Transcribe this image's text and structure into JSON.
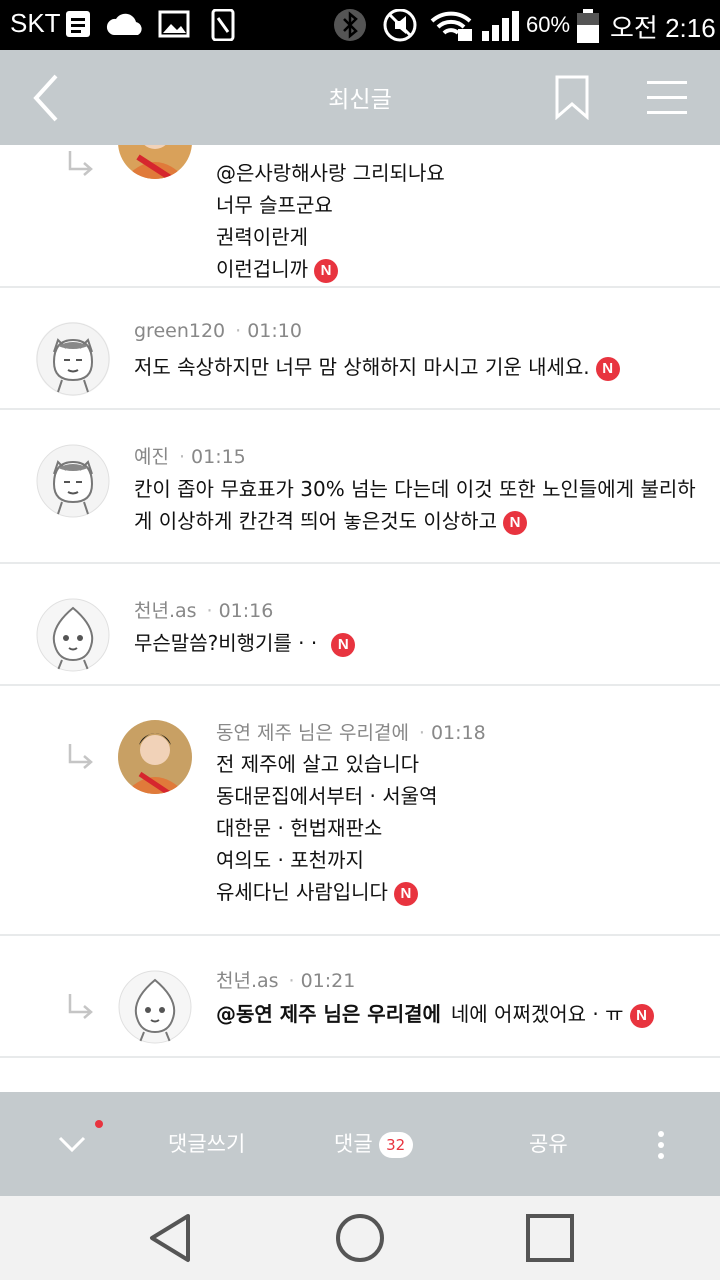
{
  "status": {
    "carrier": "SKT",
    "battery": "60%",
    "time": "오전 2:16"
  },
  "header": {
    "title": "최신글"
  },
  "comments": [
    {
      "author": "",
      "time": "",
      "lines": [
        "@은사랑해사랑 그리되나요",
        "너무 슬프군요",
        "권력이란게",
        "이런겁니까"
      ]
    },
    {
      "author": "green120",
      "time": "01:10",
      "lines": [
        "저도 속상하지만 너무 맘 상해하지 마시고 기운 내세요."
      ]
    },
    {
      "author": "예진",
      "time": "01:15",
      "lines": [
        "칸이 좁아 무효표가 30% 넘는 다는데 이것 또한 노인들에게 불리하",
        "게 이상하게 칸간격 띄어 놓은것도 이상하고"
      ]
    },
    {
      "author": "천년.as",
      "time": "01:16",
      "lines": [
        "무슨말씀?비행기를 · ·"
      ]
    },
    {
      "author": "동연 제주 님은 우리곁에",
      "time": "01:18",
      "lines": [
        "전 제주에 살고 있습니다",
        "동대문집에서부터 · 서울역",
        "대한문 · 헌법재판소",
        "여의도  · 포천까지",
        "유세다닌 사람입니다"
      ]
    },
    {
      "author": "천년.as",
      "time": "01:21",
      "mention": "@동연 제주 님은 우리곁에",
      "lines": [
        "네에 어쩌겠어요 · ㅠ"
      ]
    }
  ],
  "new_badge": "N",
  "bottombar": {
    "write": "댓글쓰기",
    "comments": "댓글",
    "comment_count": "32",
    "share": "공유"
  }
}
